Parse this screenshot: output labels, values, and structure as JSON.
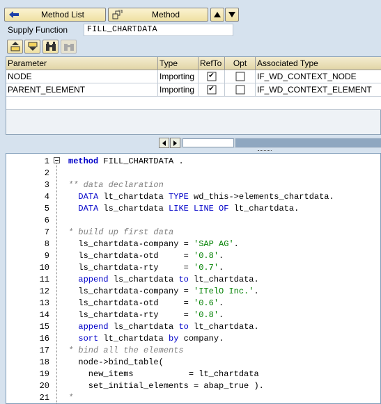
{
  "nav": {
    "method_list_label": "Method List",
    "method_label": "Method"
  },
  "supply": {
    "label": "Supply Function",
    "value": "FILL_CHARTDATA"
  },
  "table": {
    "headers": [
      "Parameter",
      "Type",
      "RefTo",
      "Opt",
      "Associated Type"
    ],
    "rows": [
      {
        "parameter": "NODE",
        "type": "Importing",
        "refto": true,
        "opt": false,
        "assoc": "IF_WD_CONTEXT_NODE"
      },
      {
        "parameter": "PARENT_ELEMENT",
        "type": "Importing",
        "refto": true,
        "opt": false,
        "assoc": "IF_WD_CONTEXT_ELEMENT"
      }
    ]
  },
  "editor": {
    "lines": [
      {
        "n": "1",
        "parts": [
          [
            "b",
            "method"
          ],
          [
            "p",
            " FILL_CHARTDATA ."
          ]
        ]
      },
      {
        "n": "2",
        "parts": []
      },
      {
        "n": "3",
        "parts": [
          [
            "c",
            "** data declaration"
          ]
        ]
      },
      {
        "n": "4",
        "parts": [
          [
            "p",
            "  "
          ],
          [
            "k",
            "DATA"
          ],
          [
            "p",
            " lt_chartdata "
          ],
          [
            "k",
            "TYPE"
          ],
          [
            "p",
            " wd_this->elements_chartdata."
          ]
        ]
      },
      {
        "n": "5",
        "parts": [
          [
            "p",
            "  "
          ],
          [
            "k",
            "DATA"
          ],
          [
            "p",
            " ls_chartdata "
          ],
          [
            "k",
            "LIKE LINE OF"
          ],
          [
            "p",
            " lt_chartdata."
          ]
        ]
      },
      {
        "n": "6",
        "parts": []
      },
      {
        "n": "7",
        "parts": [
          [
            "c",
            "* build up first data"
          ]
        ]
      },
      {
        "n": "8",
        "parts": [
          [
            "p",
            "  ls_chartdata-company = "
          ],
          [
            "s",
            "'SAP AG'"
          ],
          [
            "p",
            "."
          ]
        ]
      },
      {
        "n": "9",
        "parts": [
          [
            "p",
            "  ls_chartdata-otd     = "
          ],
          [
            "s",
            "'0.8'"
          ],
          [
            "p",
            "."
          ]
        ]
      },
      {
        "n": "10",
        "parts": [
          [
            "p",
            "  ls_chartdata-rty     = "
          ],
          [
            "s",
            "'0.7'"
          ],
          [
            "p",
            "."
          ]
        ]
      },
      {
        "n": "11",
        "parts": [
          [
            "p",
            "  "
          ],
          [
            "k",
            "append"
          ],
          [
            "p",
            " ls_chartdata "
          ],
          [
            "k",
            "to"
          ],
          [
            "p",
            " lt_chartdata."
          ]
        ]
      },
      {
        "n": "12",
        "parts": [
          [
            "p",
            "  ls_chartdata-company = "
          ],
          [
            "s",
            "'ITelO Inc.'"
          ],
          [
            "p",
            "."
          ]
        ]
      },
      {
        "n": "13",
        "parts": [
          [
            "p",
            "  ls_chartdata-otd     = "
          ],
          [
            "s",
            "'0.6'"
          ],
          [
            "p",
            "."
          ]
        ]
      },
      {
        "n": "14",
        "parts": [
          [
            "p",
            "  ls_chartdata-rty     = "
          ],
          [
            "s",
            "'0.8'"
          ],
          [
            "p",
            "."
          ]
        ]
      },
      {
        "n": "15",
        "parts": [
          [
            "p",
            "  "
          ],
          [
            "k",
            "append"
          ],
          [
            "p",
            " ls_chartdata "
          ],
          [
            "k",
            "to"
          ],
          [
            "p",
            " lt_chartdata."
          ]
        ]
      },
      {
        "n": "16",
        "parts": [
          [
            "p",
            "  "
          ],
          [
            "k",
            "sort"
          ],
          [
            "p",
            " lt_chartdata "
          ],
          [
            "k",
            "by"
          ],
          [
            "p",
            " company."
          ]
        ]
      },
      {
        "n": "17",
        "parts": [
          [
            "c",
            "* bind all the elements"
          ]
        ]
      },
      {
        "n": "18",
        "parts": [
          [
            "p",
            "  node->bind_table("
          ]
        ]
      },
      {
        "n": "19",
        "parts": [
          [
            "p",
            "    new_items           = lt_chartdata"
          ]
        ]
      },
      {
        "n": "20",
        "parts": [
          [
            "p",
            "    set_initial_elements = abap_true )."
          ]
        ]
      },
      {
        "n": "21",
        "parts": [
          [
            "c",
            "*"
          ]
        ]
      }
    ]
  }
}
